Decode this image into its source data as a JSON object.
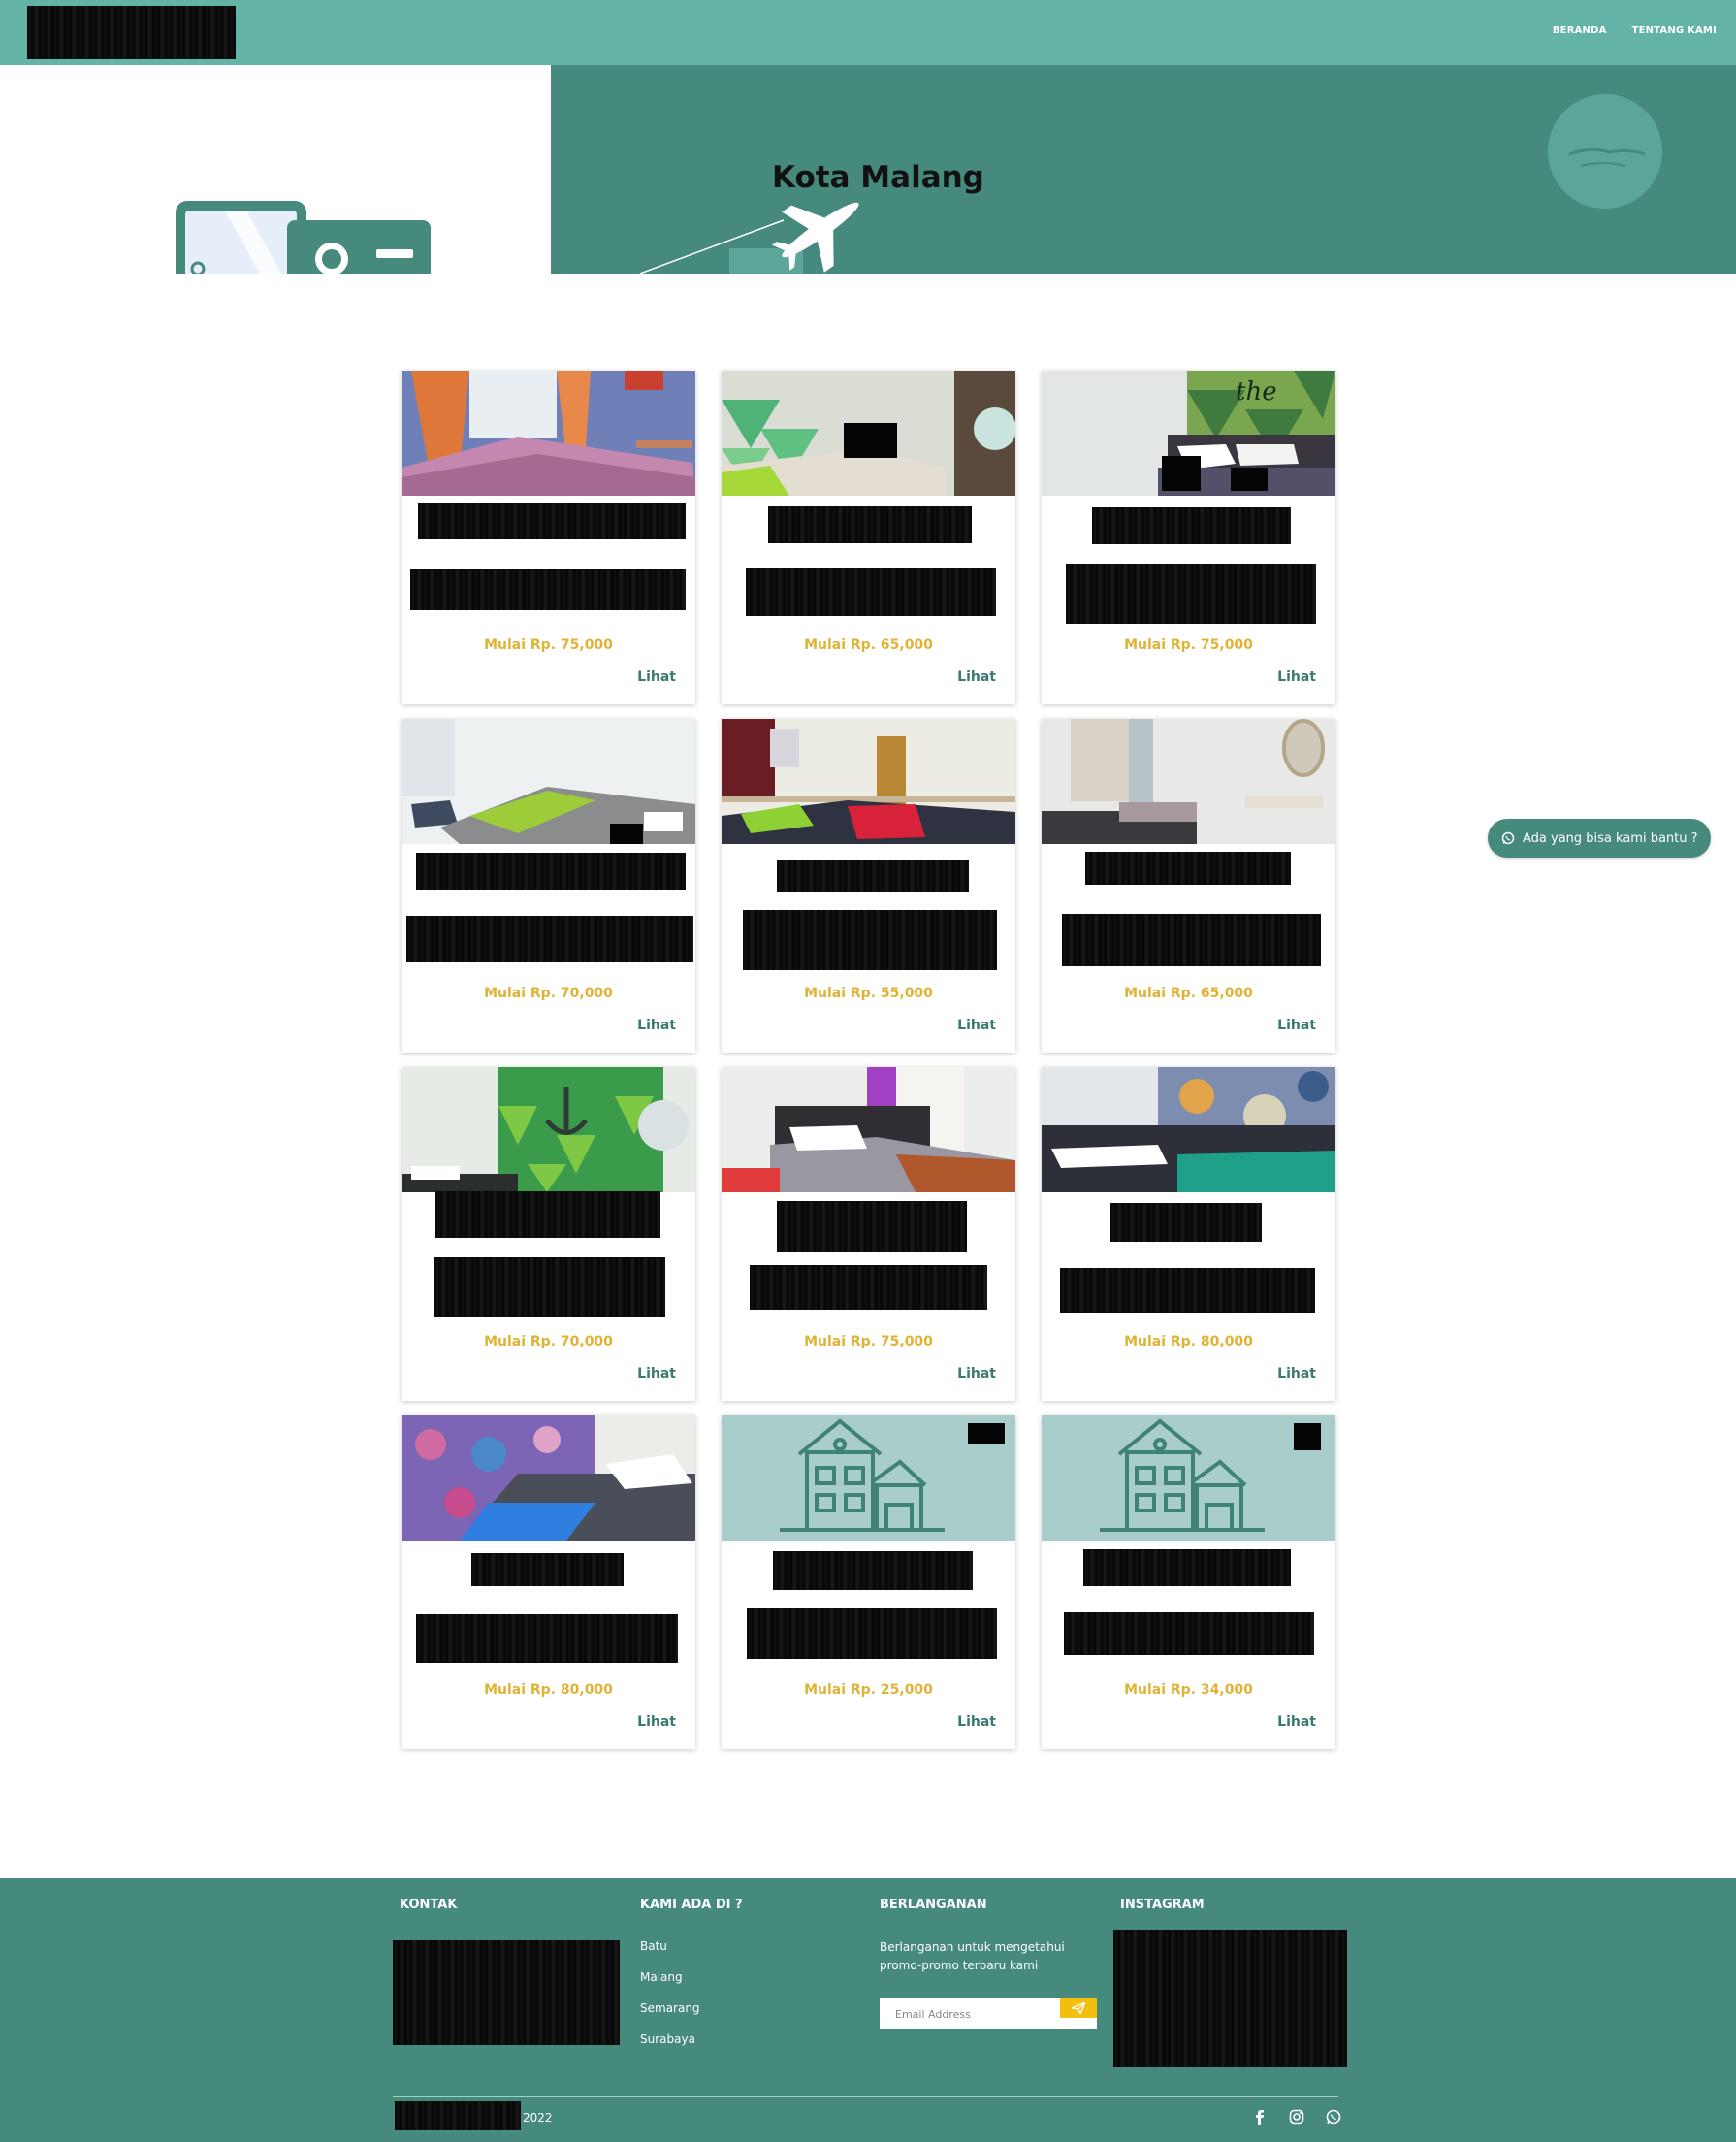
{
  "header": {
    "nav": [
      {
        "label": "BERANDA"
      },
      {
        "label": "TENTANG KAMI"
      }
    ]
  },
  "hero": {
    "title": "Kota Malang"
  },
  "listings": [
    {
      "price": "Mulai Rp. 75,000",
      "link": "Lihat"
    },
    {
      "price": "Mulai Rp. 65,000",
      "link": "Lihat"
    },
    {
      "price": "Mulai Rp. 75,000",
      "link": "Lihat"
    },
    {
      "price": "Mulai Rp. 70,000",
      "link": "Lihat"
    },
    {
      "price": "Mulai Rp. 55,000",
      "link": "Lihat"
    },
    {
      "price": "Mulai Rp. 65,000",
      "link": "Lihat"
    },
    {
      "price": "Mulai Rp. 70,000",
      "link": "Lihat"
    },
    {
      "price": "Mulai Rp. 75,000",
      "link": "Lihat"
    },
    {
      "price": "Mulai Rp. 80,000",
      "link": "Lihat"
    },
    {
      "price": "Mulai Rp. 80,000",
      "link": "Lihat"
    },
    {
      "price": "Mulai Rp. 25,000",
      "link": "Lihat"
    },
    {
      "price": "Mulai Rp. 34,000",
      "link": "Lihat"
    }
  ],
  "help": {
    "label": "Ada yang bisa kami bantu ?"
  },
  "footer": {
    "kontak_heading": "KONTAK",
    "locations_heading": "KAMI ADA DI ?",
    "locations": [
      "Batu",
      "Malang",
      "Semarang",
      "Surabaya"
    ],
    "subscribe_heading": "BERLANGANAN",
    "subscribe_text": "Berlanganan untuk mengetahui promo-promo terbaru kami",
    "email_placeholder": "Email Address",
    "instagram_heading": "INSTAGRAM",
    "copyright_year": "2022"
  },
  "colors": {
    "header": "#63b3a6",
    "primary_dark": "#458a7d",
    "price": "#e0b336",
    "link": "#3a7a70",
    "send_button": "#f2bf0f"
  }
}
